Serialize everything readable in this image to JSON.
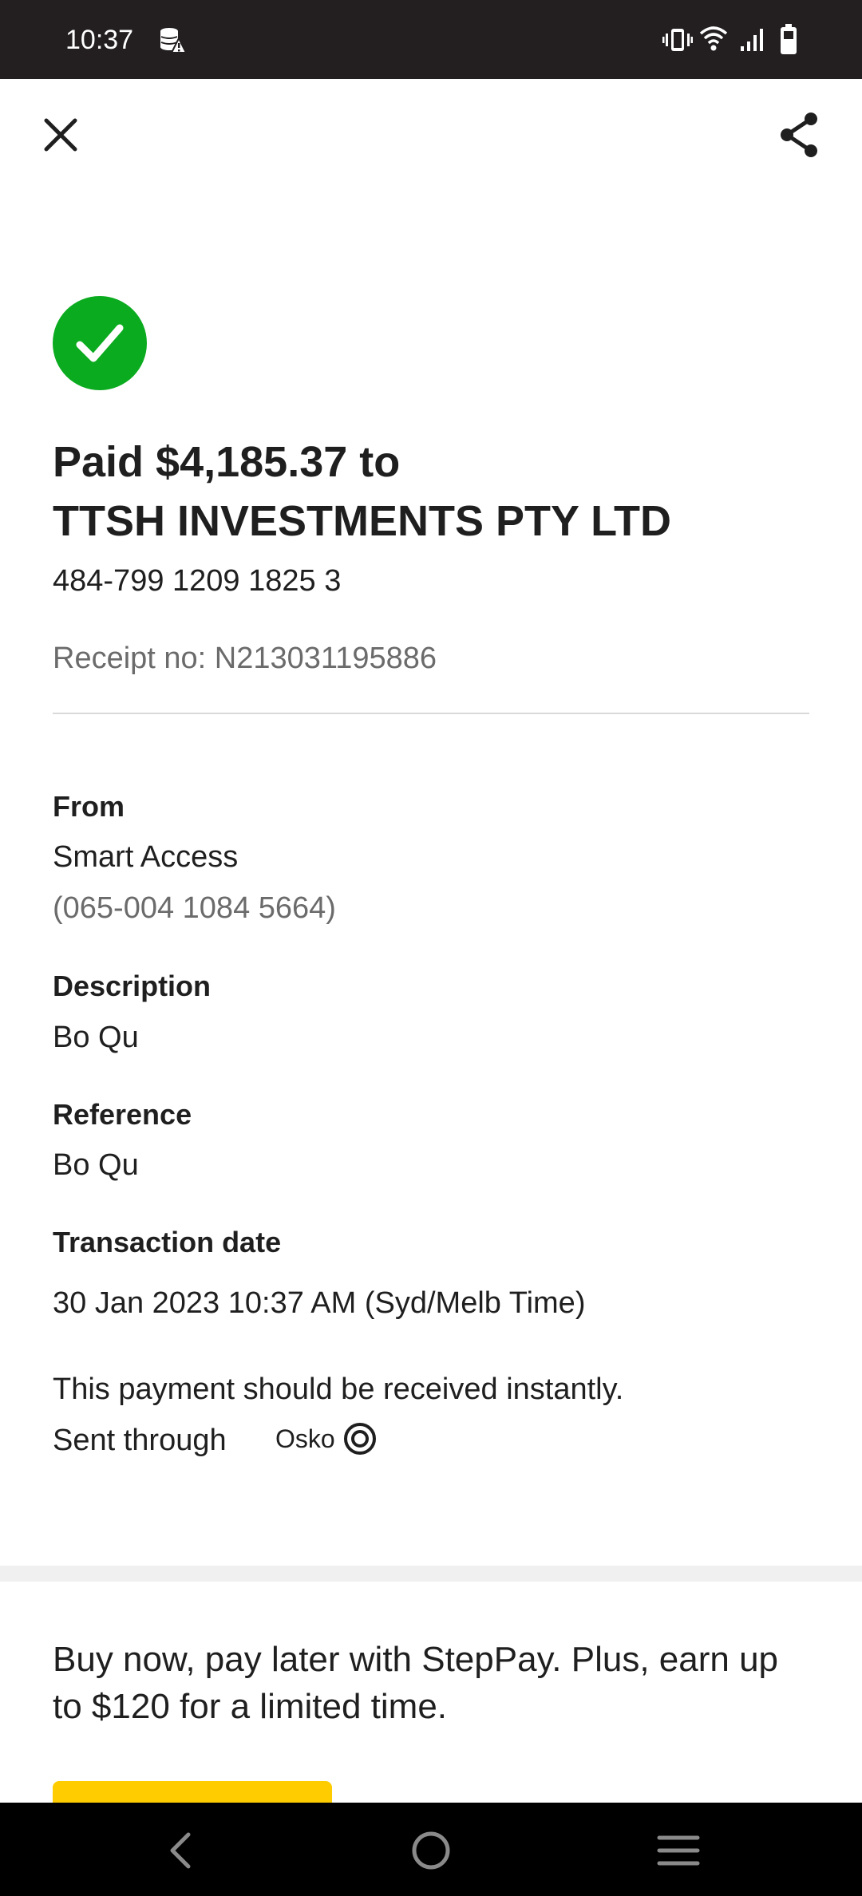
{
  "status_bar": {
    "time": "10:37",
    "left_icons": [
      "data-saver-alert-icon"
    ],
    "right_icons": [
      "vibrate-icon",
      "wifi-icon",
      "signal-icon",
      "battery-icon"
    ]
  },
  "top_bar": {
    "close_icon": "close-icon",
    "share_icon": "share-icon"
  },
  "payment": {
    "status_icon": "check-circle-icon",
    "status_color": "#0aab1f",
    "title_line1": "Paid $4,185.37 to",
    "title_line2": "TTSH INVESTMENTS PTY LTD",
    "account_number": "484-799 1209 1825 3",
    "receipt": "Receipt no: N213031195886"
  },
  "details": {
    "from_label": "From",
    "from_account_name": "Smart Access",
    "from_account_number": "(065-004 1084 5664)",
    "description_label": "Description",
    "description_value": "Bo Qu",
    "reference_label": "Reference",
    "reference_value": "Bo Qu",
    "transaction_date_label": "Transaction date",
    "transaction_date_value": "30 Jan 2023 10:37 AM (Syd/Melb Time)",
    "instant_note": "This payment should be received instantly.",
    "sent_through_label": "Sent through",
    "osko_logo_text": "Osko"
  },
  "promo": {
    "text": "Buy now, pay later with StepPay. Plus, earn up to $120 for a limited time.",
    "button_color": "#ffcc00"
  },
  "nav_bar": {
    "icons": [
      "back-icon",
      "home-icon",
      "recents-icon"
    ]
  }
}
